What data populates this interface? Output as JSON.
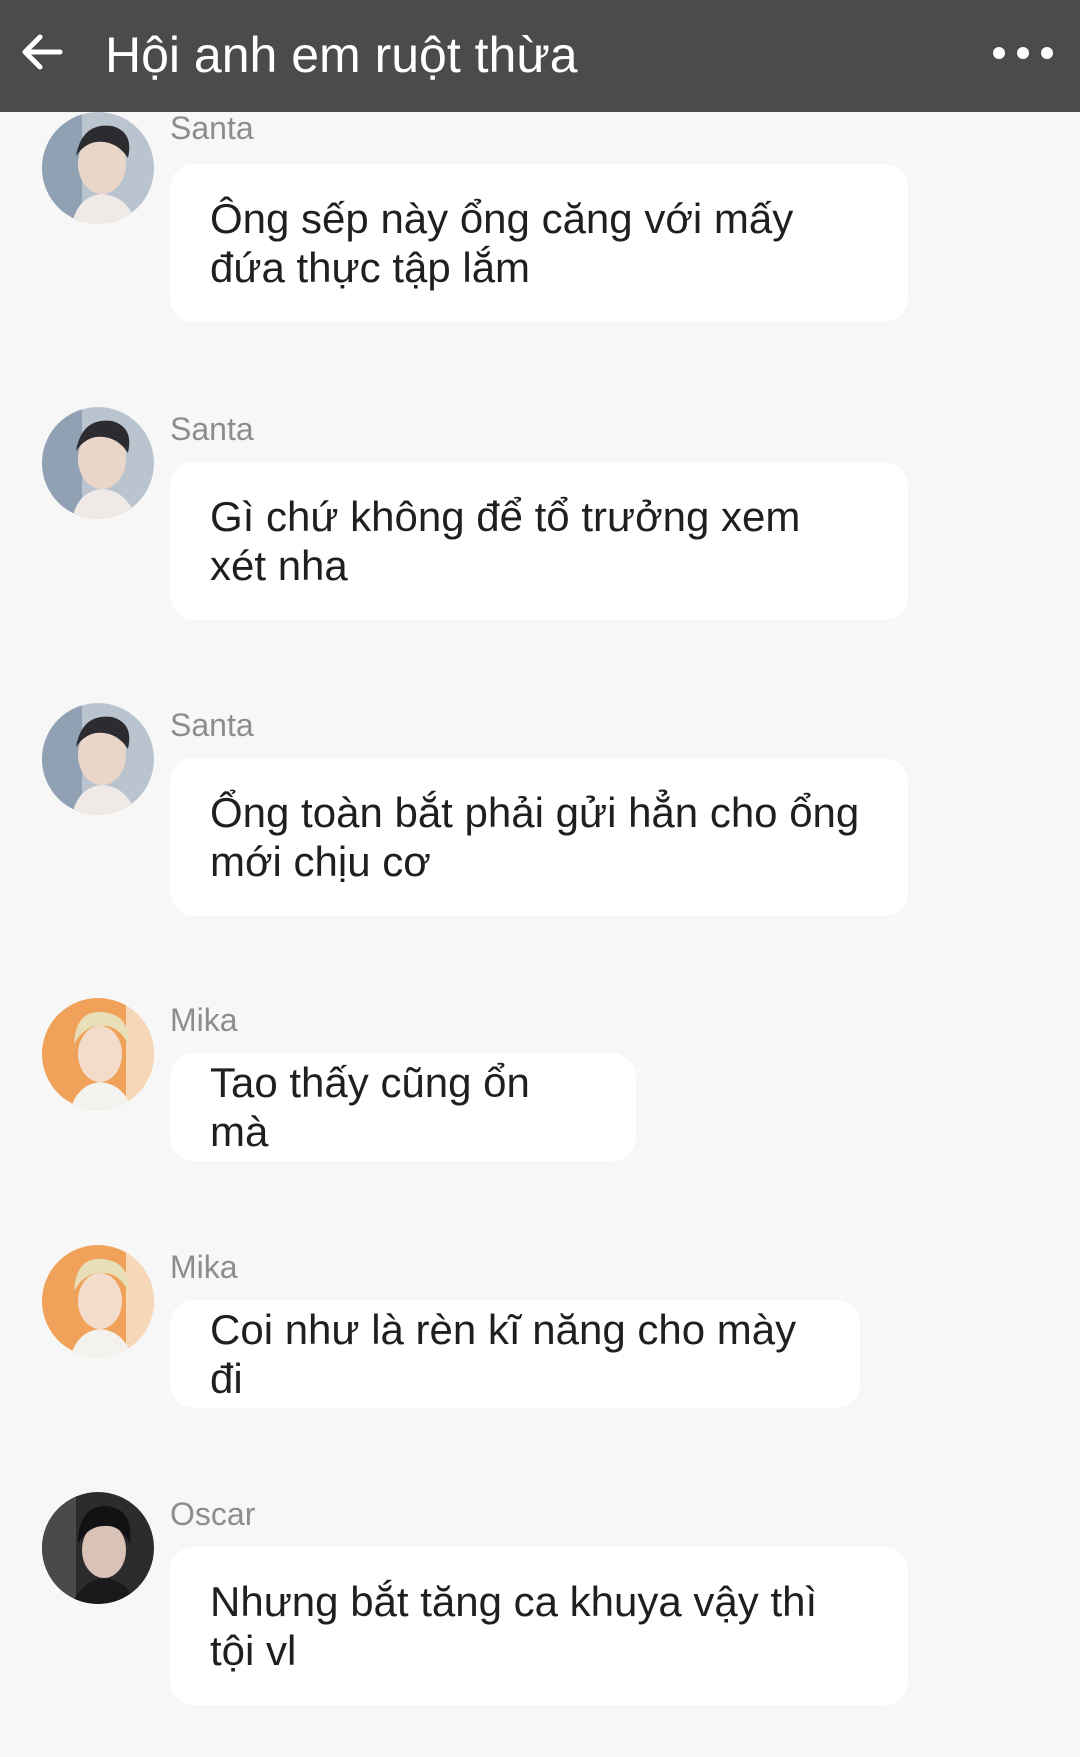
{
  "header": {
    "title": "Hội anh em ruột thừa",
    "back_icon": "arrow-left-icon",
    "menu_icon": "more-horizontal-icon"
  },
  "messages": [
    {
      "sender": "Santa",
      "text": "Ông sếp này ổng căng với mấy đứa thực tập lắm"
    },
    {
      "sender": "Santa",
      "text": "Gì chứ không để tổ trưởng xem xét nha"
    },
    {
      "sender": "Santa",
      "text": "Ổng toàn bắt phải gửi hẳn cho ổng mới chịu cơ"
    },
    {
      "sender": "Mika",
      "text": "Tao thấy cũng ổn mà"
    },
    {
      "sender": "Mika",
      "text": "Coi như là rèn kĩ năng cho mày đi"
    },
    {
      "sender": "Oscar",
      "text": "Nhưng bắt tăng ca khuya vậy thì tội vl"
    }
  ],
  "colors": {
    "header_bg": "#4b4b4b",
    "page_bg": "#f7f7f7",
    "bubble_bg": "#ffffff",
    "sender_text": "#8d8d8d"
  }
}
